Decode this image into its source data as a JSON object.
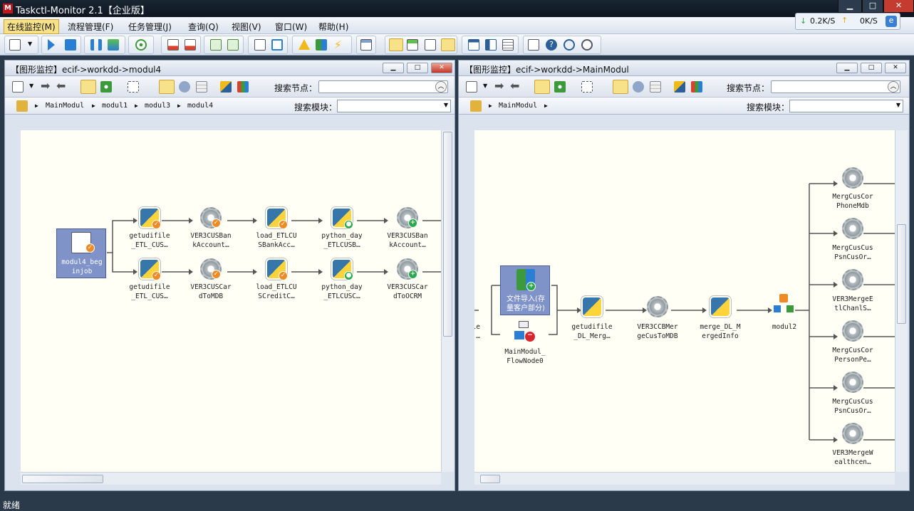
{
  "app": {
    "title": "Taskctl-Monitor 2.1【企业版】",
    "logo": "M"
  },
  "menu": [
    "在线监控(M)",
    "流程管理(F)",
    "任务管理(J)",
    "查询(Q)",
    "视图(V)",
    "窗口(W)",
    "帮助(H)"
  ],
  "net": {
    "down": "0.2K/S",
    "up": "0K/S"
  },
  "left_panel": {
    "title": "【图形监控】ecif->workdd->modul4",
    "search_node_label": "搜索节点：",
    "search_module_label": "搜索模块：",
    "breadcrumb": [
      "MainModul",
      "modul1",
      "modul3",
      "modul4"
    ],
    "start_node": "modul4_beg\ninjob",
    "row1": [
      "getudifile\n_ETL_CUS…",
      "VER3CUSBan\nkAccount…",
      "load_ETLCU\nSBankAcc…",
      "python_day\n_ETLCUSB…",
      "VER3CUSBan\nkAccount…"
    ],
    "row2": [
      "getudifile\n_ETL_CUS…",
      "VER3CUSCar\ndToMDB",
      "load_ETLCU\nSCreditC…",
      "python_day\n_ETLCUSC…",
      "VER3CUSCar\ndToOCRM"
    ]
  },
  "right_panel": {
    "title": "【图形监控】ecif->workdd->MainModul",
    "search_node_label": "搜索节点：",
    "search_module_label": "搜索模块：",
    "breadcrumb": [
      "MainModul"
    ],
    "partial_left": "le\n…",
    "group_node": "文件导入(存\n量客户部分)",
    "flow_node": "MainModul_\nFlowNode0",
    "chain": [
      "getudifile\n_DL_Merg…",
      "VER3CCBMer\ngeCusToMDB",
      "merge_DL_M\nergedInfo",
      "modul2"
    ],
    "right_column": [
      "MergCusCor\nPhoneMdb",
      "MergCusCus\nPsnCusOr…",
      "VER3MergeE\ntlChanlS…",
      "MergCusCor\nPersonPe…",
      "MergCusCus\nPsnCusOr…",
      "VER3MergeW\nealthcen…"
    ]
  },
  "status": "就绪",
  "colors": {
    "orange_badge": "#f08a24",
    "green_badge": "#2aa84a",
    "red_badge": "#d8262f",
    "selected_node": "#7f93c9"
  }
}
